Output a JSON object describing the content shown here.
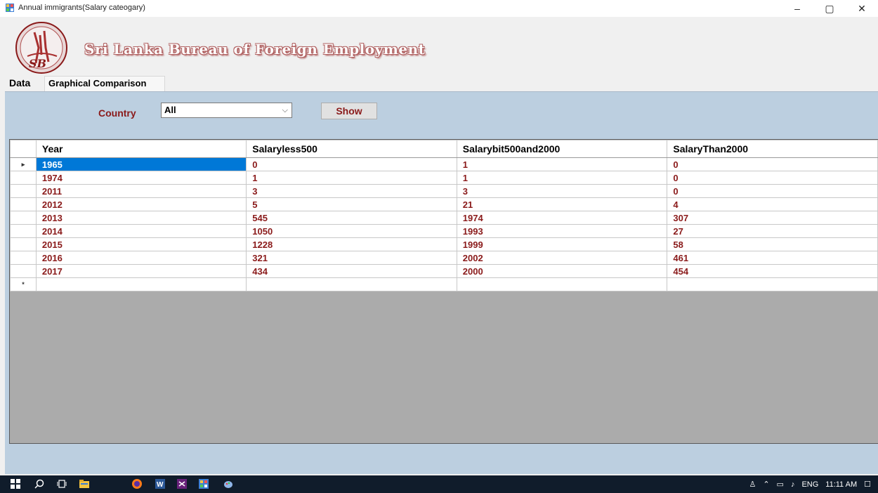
{
  "window": {
    "title": "Annual immigrants(Salary cateogary)",
    "minimize": "–",
    "restore": "▢",
    "close": "✕"
  },
  "header": {
    "org_name": "Sri Lanka Bureau of Foreign Employment",
    "logo_text": "SB"
  },
  "tabs": [
    {
      "label": "Data",
      "active": true
    },
    {
      "label": "Graphical Comparison",
      "active": false
    }
  ],
  "filter": {
    "country_label": "Country",
    "country_value": "All",
    "dropdown_arrow": "⌵",
    "show_label": "Show"
  },
  "grid": {
    "columns": [
      "Year",
      "Salaryless500",
      "Salarybit500and2000",
      "SalaryThan2000"
    ],
    "rows": [
      [
        "1965",
        "0",
        "1",
        "0"
      ],
      [
        "1974",
        "1",
        "1",
        "0"
      ],
      [
        "2011",
        "3",
        "3",
        "0"
      ],
      [
        "2012",
        "5",
        "21",
        "4"
      ],
      [
        "2013",
        "545",
        "1974",
        "307"
      ],
      [
        "2014",
        "1050",
        "1993",
        "27"
      ],
      [
        "2015",
        "1228",
        "1999",
        "58"
      ],
      [
        "2016",
        "321",
        "2002",
        "461"
      ],
      [
        "2017",
        "434",
        "2000",
        "454"
      ]
    ],
    "current_row_marker": "▸",
    "new_row_marker": "*"
  },
  "taskbar": {
    "language": "ENG",
    "time": "11:11 AM"
  },
  "colors": {
    "accent_text": "#8a1a1a",
    "selection": "#0078d7",
    "panel": "#bccfe0",
    "taskbar": "#101c2b"
  }
}
